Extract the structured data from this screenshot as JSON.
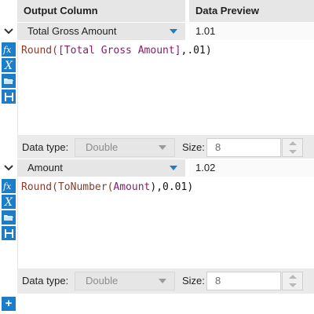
{
  "columns": {
    "output": "Output Column",
    "preview": "Data Preview"
  },
  "fields": [
    {
      "name": "Total Gross Amount",
      "preview": "1.01",
      "expression": {
        "fn": "Round(",
        "field": "[Total Gross Amount]",
        "rest": ",.01)"
      },
      "data_type_label": "Data type:",
      "data_type": "Double",
      "size_label": "Size:",
      "size": "8"
    },
    {
      "name": "Amount",
      "preview": "1.02",
      "expression": {
        "fn": "Round(ToNumber(",
        "field": "Amount",
        "rest": "),0.01)"
      },
      "data_type_label": "Data type:",
      "data_type": "Double",
      "size_label": "Size:",
      "size": "8"
    }
  ],
  "icons": {
    "fx": "function-icon",
    "x": "variable-icon",
    "open": "open-folder-icon",
    "save": "save-icon",
    "add": "add-icon"
  },
  "accent": "#1c7dc9",
  "add_label": "+"
}
